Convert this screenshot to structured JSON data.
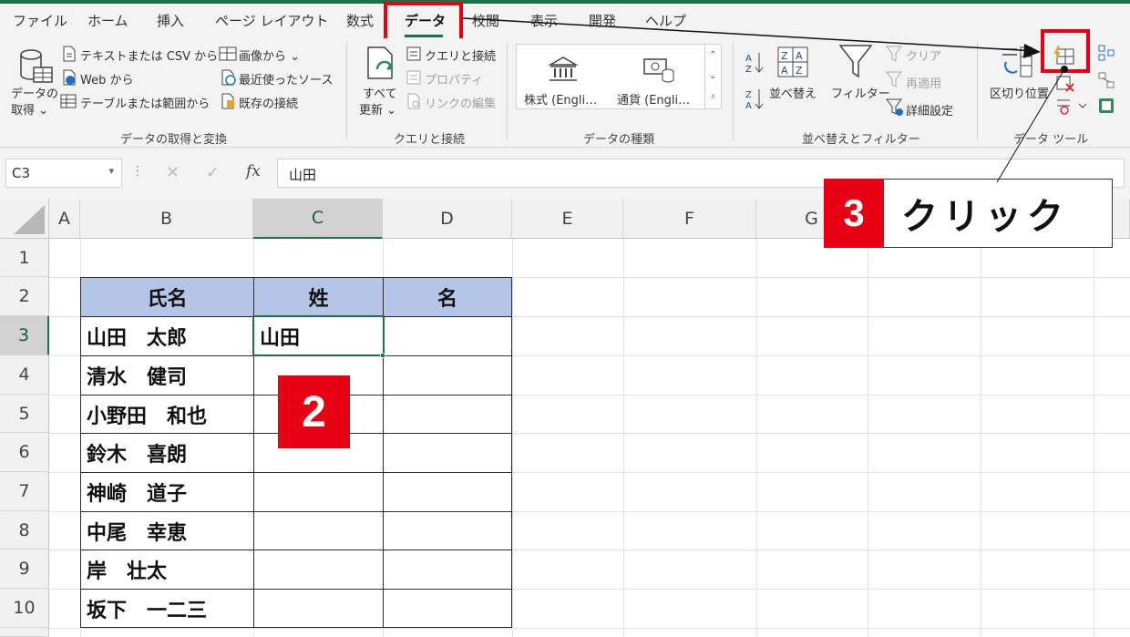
{
  "menu": {
    "tabs": [
      "ファイル",
      "ホーム",
      "挿入",
      "ページ レイアウト",
      "数式",
      "データ",
      "校閲",
      "表示",
      "開発",
      "ヘルプ"
    ],
    "active": "データ"
  },
  "ribbon": {
    "get_data": {
      "line1": "データの",
      "line2": "取得 ⌄"
    },
    "text_csv": "テキストまたは CSV から",
    "web": "Web から",
    "table_range": "テーブルまたは範囲から",
    "from_image": "画像から ⌄",
    "recent_sources": "最近使ったソース",
    "existing_conn": "既存の接続",
    "group1": "データの取得と変換",
    "refresh_all": {
      "line1": "すべて",
      "line2": "更新 ⌄"
    },
    "queries_conn": "クエリと接続",
    "properties": "プロパティ",
    "edit_links": "リンクの編集",
    "group2": "クエリと接続",
    "stocks": "株式 (Engli…",
    "currency": "通貨 (Engli…",
    "group3": "データの種類",
    "sort": "並べ替え",
    "filter": "フィルター",
    "clear": "クリア",
    "reapply": "再適用",
    "advanced": "詳細設定",
    "group4": "並べ替えとフィルター",
    "text_to_columns": "区切り位置",
    "group5": "データ ツール"
  },
  "formula_bar": {
    "name_box": "C3",
    "fx": "fx",
    "value": "山田"
  },
  "columns": [
    "A",
    "B",
    "C",
    "D",
    "E",
    "F",
    "G"
  ],
  "rows": [
    "1",
    "2",
    "3",
    "4",
    "5",
    "6",
    "7",
    "8",
    "9",
    "10"
  ],
  "table": {
    "headers": [
      "氏名",
      "姓",
      "名"
    ],
    "names": [
      "山田　太郎",
      "清水　健司",
      "小野田　和也",
      "鈴木　喜朗",
      "神崎　道子",
      "中尾　幸恵",
      "岸　壮太",
      "坂下　一二三"
    ],
    "c3": "山田"
  },
  "annotations": {
    "step2": "2",
    "step3_number": "3",
    "step3_text": "クリック"
  },
  "colors": {
    "accent": "#217346",
    "highlight": "#e60012",
    "header_fill": "#b4c6e7"
  }
}
